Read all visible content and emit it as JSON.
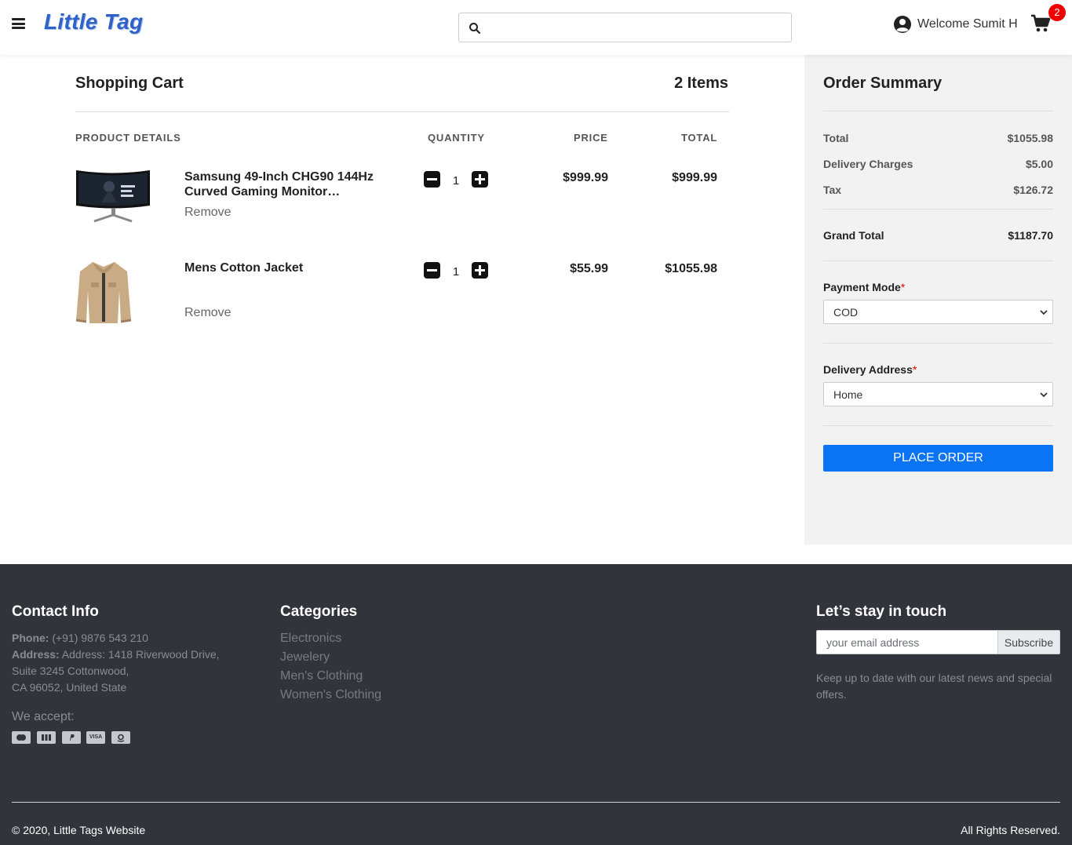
{
  "header": {
    "logo": "Little Tag",
    "search_placeholder": "",
    "welcome": "Welcome Sumit H",
    "cart_count": "2"
  },
  "cart": {
    "title": "Shopping Cart",
    "items_count": "2 Items",
    "columns": {
      "product": "PRODUCT DETAILS",
      "quantity": "QUANTITY",
      "price": "PRICE",
      "total": "TOTAL"
    },
    "items": [
      {
        "name": "Samsung 49-Inch CHG90 144Hz Curved Gaming Monitor…",
        "remove": "Remove",
        "quantity": "1",
        "price": "$999.99",
        "total": "$999.99",
        "image_icon": "curved-monitor-image"
      },
      {
        "name": "Mens Cotton Jacket",
        "remove": "Remove",
        "quantity": "1",
        "price": "$55.99",
        "total": "$1055.98",
        "image_icon": "jacket-image"
      }
    ]
  },
  "summary": {
    "title": "Order Summary",
    "total_label": "Total",
    "total_value": "$1055.98",
    "delivery_label": "Delivery Charges",
    "delivery_value": "$5.00",
    "tax_label": "Tax",
    "tax_value": "$126.72",
    "grand_label": "Grand Total",
    "grand_value": "$1187.70",
    "payment_label": "Payment Mode",
    "payment_value": "COD",
    "address_label": "Delivery Address",
    "address_value": "Home",
    "required_mark": "*",
    "place_order": "PLACE ORDER"
  },
  "footer": {
    "contact_heading": "Contact Info",
    "phone_label": "Phone:",
    "phone_value": " (+91) 9876 543 210",
    "address_label": "Address:",
    "address_line1": " Address: 1418 Riverwood Drive,",
    "address_line2": "Suite 3245 Cottonwood,",
    "address_line3": "CA 96052, United State",
    "we_accept": "We accept:",
    "payment_icons": [
      "mastercard-icon",
      "jcb-icon",
      "paypal-icon",
      "visa-icon",
      "amazon-icon"
    ],
    "visa_text": "VISA",
    "categories_heading": "Categories",
    "categories": [
      "Electronics",
      "Jewelery",
      "Men's Clothing",
      "Women's Clothing"
    ],
    "newsletter_heading": "Let’s stay in touch",
    "email_placeholder": "your email address",
    "subscribe": "Subscribe",
    "newsletter_text1": "Keep up to date with our latest news and special",
    "newsletter_text2": "offers.",
    "copyright": "© 2020, Little Tags Website",
    "rights": "All Rights Reserved."
  },
  "colors": {
    "accent": "#0a74f5",
    "badge": "#ee0000",
    "footer_bg": "#32343b",
    "summary_bg": "#f2f2f2",
    "logo": "#2f62c7"
  }
}
